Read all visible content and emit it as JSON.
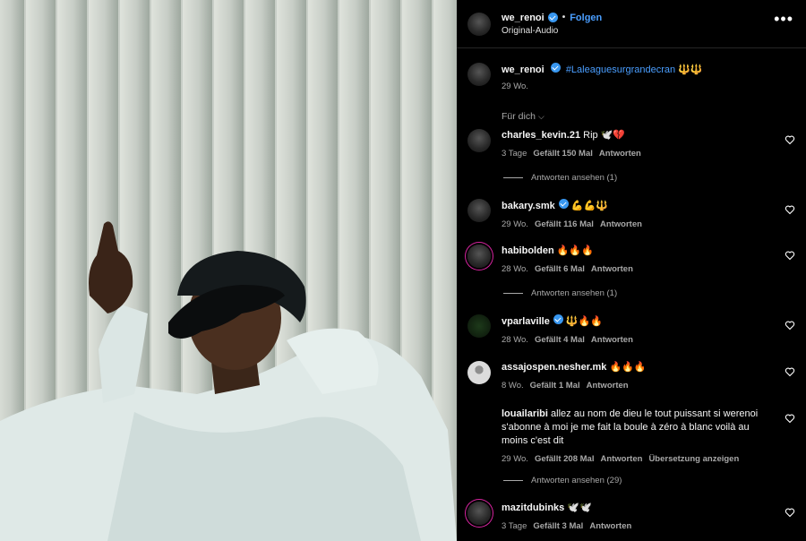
{
  "header": {
    "username": "we_renoi",
    "follow_label": "Folgen",
    "audio_label": "Original-Audio",
    "more_label": "•••"
  },
  "caption": {
    "username": "we_renoi",
    "text": "#Laleaguesurgrandecran 🔱🔱",
    "time": "29 Wo."
  },
  "filter": {
    "label": "Für dich",
    "chevron": "⌵"
  },
  "comments": [
    {
      "username": "charles_kevin.21",
      "text": "Rip 🕊️💔",
      "time": "3 Tage",
      "likes": "Gefällt 150 Mal",
      "reply": "Antworten",
      "view_replies": "Antworten ansehen (1)"
    },
    {
      "username": "bakary.smk",
      "text": "💪💪🔱",
      "time": "29 Wo.",
      "likes": "Gefällt 116 Mal",
      "reply": "Antworten"
    },
    {
      "username": "habibolden",
      "text": "🔥🔥🔥",
      "time": "28 Wo.",
      "likes": "Gefällt 6 Mal",
      "reply": "Antworten",
      "view_replies": "Antworten ansehen (1)"
    },
    {
      "username": "vparlaville",
      "text": "🔱🔥🔥",
      "time": "28 Wo.",
      "likes": "Gefällt 4 Mal",
      "reply": "Antworten"
    },
    {
      "username": "assajospen.nesher.mk",
      "text": "🔥🔥🔥",
      "time": "8 Wo.",
      "likes": "Gefällt 1 Mal",
      "reply": "Antworten"
    },
    {
      "username": "louailaribi",
      "text": "allez au nom de dieu le tout puissant si werenoi s'abonne à moi je me fait la boule à zéro à blanc voilà au moins c'est dit",
      "time": "29 Wo.",
      "likes": "Gefällt 208 Mal",
      "reply": "Antworten",
      "translate": "Übersetzung anzeigen",
      "view_replies": "Antworten ansehen (29)"
    },
    {
      "username": "mazitdubinks",
      "text": "🕊️🕊️",
      "time": "3 Tage",
      "likes": "Gefällt 3 Mal",
      "reply": "Antworten"
    }
  ],
  "colors": {
    "link": "#4a9eff",
    "verified": "#3897f0",
    "muted": "#a8a8a8",
    "story_ring": "#d6249f"
  }
}
